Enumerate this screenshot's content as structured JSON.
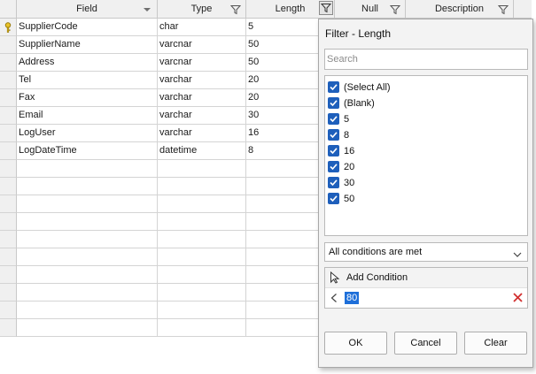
{
  "columns": [
    {
      "label": "Field",
      "icon": "sort-desc-icon"
    },
    {
      "label": "Type",
      "icon": "filter-icon"
    },
    {
      "label": "Length",
      "icon": "filter-active-icon"
    },
    {
      "label": "Null",
      "icon": "filter-icon"
    },
    {
      "label": "Description",
      "icon": "filter-icon"
    }
  ],
  "rows": [
    {
      "field": "SupplierCode",
      "type": "char",
      "length": "5",
      "key": true
    },
    {
      "field": "SupplierName",
      "type": "varcnar",
      "length": "50"
    },
    {
      "field": "Address",
      "type": "varcnar",
      "length": "50"
    },
    {
      "field": "Tel",
      "type": "varchar",
      "length": "20"
    },
    {
      "field": "Fax",
      "type": "varchar",
      "length": "20"
    },
    {
      "field": "Email",
      "type": "varchar",
      "length": "30"
    },
    {
      "field": "LogUser",
      "type": "varchar",
      "length": "16"
    },
    {
      "field": "LogDateTime",
      "type": "datetime",
      "length": "8"
    }
  ],
  "filter": {
    "title": "Filter - Length",
    "search_placeholder": "Search",
    "values": [
      {
        "label": "(Select All)",
        "checked": true
      },
      {
        "label": "(Blank)",
        "checked": true
      },
      {
        "label": "5",
        "checked": true
      },
      {
        "label": "8",
        "checked": true
      },
      {
        "label": "16",
        "checked": true
      },
      {
        "label": "20",
        "checked": true
      },
      {
        "label": "30",
        "checked": true
      },
      {
        "label": "50",
        "checked": true
      }
    ],
    "condition_mode": "All conditions are met",
    "add_condition_label": "Add Condition",
    "condition": {
      "operator": "<",
      "value": "80"
    },
    "buttons": {
      "ok": "OK",
      "cancel": "Cancel",
      "clear": "Clear"
    }
  },
  "colors": {
    "accent": "#1e5fbb",
    "selection": "#1e6fd9",
    "delete": "#d12f2f",
    "key": "#d4a017"
  }
}
